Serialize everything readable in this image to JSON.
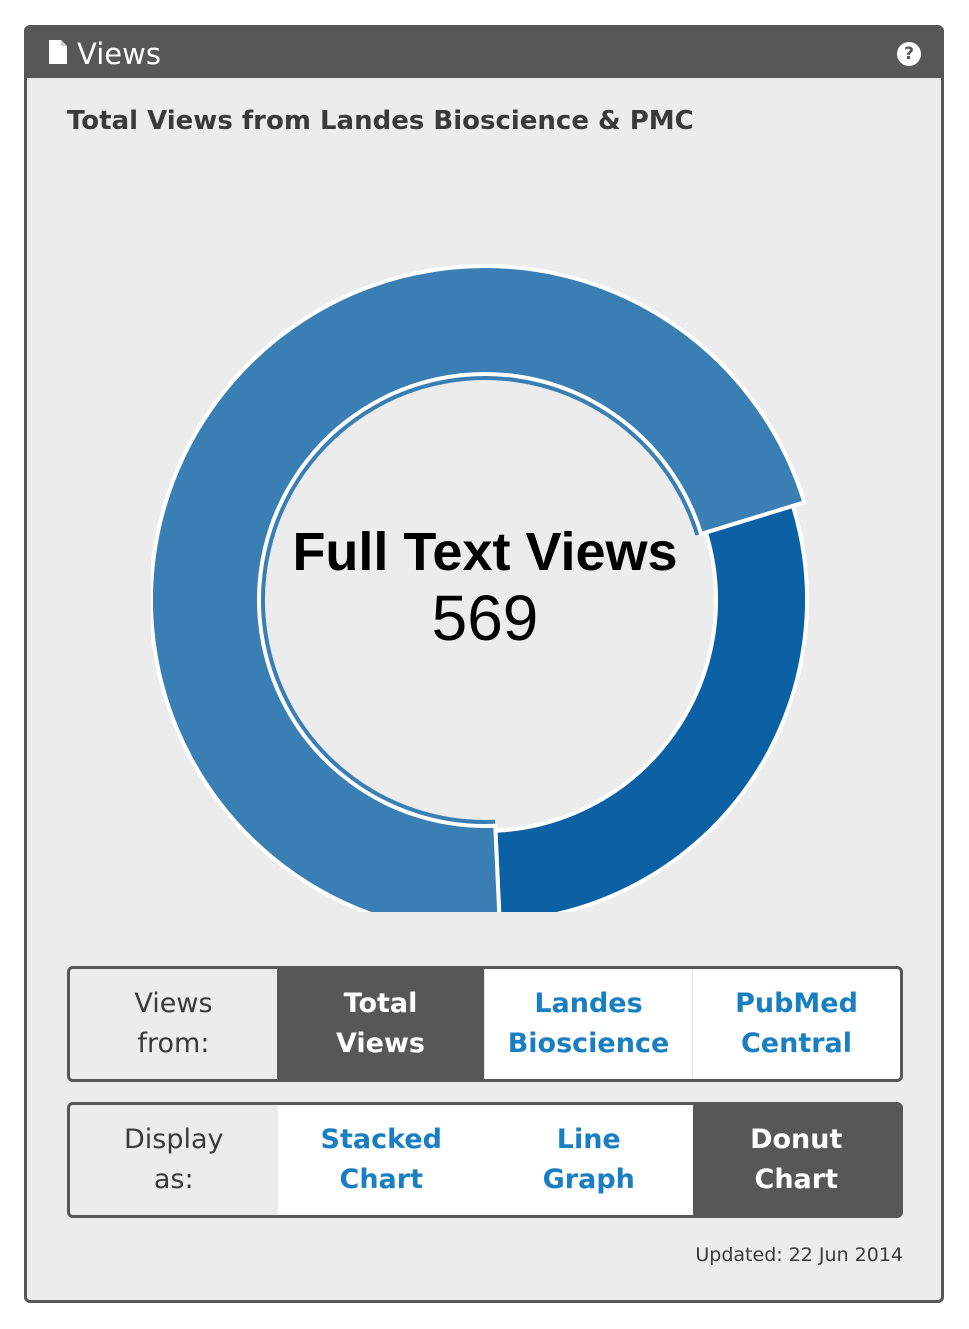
{
  "panel": {
    "title": "Views",
    "help_label": "?",
    "icon": "document-icon"
  },
  "subtitle": "Total Views from Landes Bioscience & PMC",
  "donut": {
    "center_label": "Full Text Views",
    "center_value": "569",
    "colors": {
      "outer_segment": "#3a7fb4",
      "inner_segment": "#0c60a4"
    }
  },
  "chart_data": {
    "type": "pie",
    "title": "Full Text Views",
    "total": 569,
    "segments": [
      {
        "share": 0.29,
        "color": "#0c60a4"
      },
      {
        "share": 0.71,
        "color": "#3a7fb4"
      }
    ]
  },
  "views_from": {
    "label": [
      "Views",
      "from:"
    ],
    "options": [
      {
        "lines": [
          "Total",
          "Views"
        ],
        "active": true
      },
      {
        "lines": [
          "Landes",
          "Bioscience"
        ],
        "active": false
      },
      {
        "lines": [
          "PubMed",
          "Central"
        ],
        "active": false
      }
    ]
  },
  "display_as": {
    "label": [
      "Display",
      "as:"
    ],
    "options": [
      {
        "lines": [
          "Stacked",
          "Chart"
        ],
        "active": false
      },
      {
        "lines": [
          "Line",
          "Graph"
        ],
        "active": false
      },
      {
        "lines": [
          "Donut",
          "Chart"
        ],
        "active": true
      }
    ]
  },
  "updated": "Updated: 22 Jun 2014",
  "colors": {
    "dark": "#575757",
    "panel_bg": "#ececec",
    "link": "#1a7fc2"
  }
}
